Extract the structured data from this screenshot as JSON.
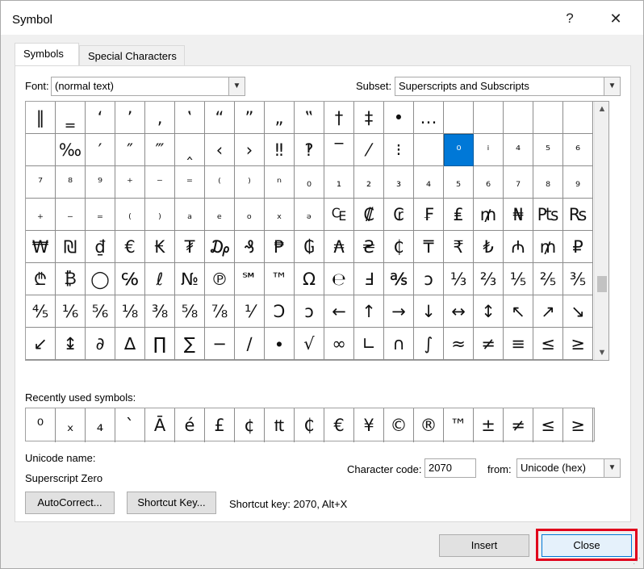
{
  "dialog": {
    "title": "Symbol",
    "help_label": "?",
    "close_label": "✕"
  },
  "tabs": [
    {
      "label": "Symbols",
      "active": true
    },
    {
      "label": "Special Characters",
      "active": false
    }
  ],
  "font": {
    "label": "Font:",
    "value": "(normal text)"
  },
  "subset": {
    "label": "Subset:",
    "value": "Superscripts and Subscripts"
  },
  "symbol_grid": {
    "rows": [
      [
        "‖",
        "‗",
        "‘",
        "’",
        "‚",
        "‛",
        "“",
        "”",
        "„",
        "‟",
        "†",
        "‡",
        "•",
        "…",
        "",
        "",
        "",
        ""
      ],
      [
        "",
        "‰",
        "′",
        "″",
        "‴",
        "‸",
        "‹",
        "›",
        "‼",
        "‽",
        "‾",
        "⁄",
        "⁝",
        "",
        "⁰",
        "ⁱ",
        "⁴",
        "⁵",
        "⁶"
      ],
      [
        "⁷",
        "⁸",
        "⁹",
        "⁺",
        "⁻",
        "⁼",
        "⁽",
        "⁾",
        "ⁿ",
        "₀",
        "₁",
        "₂",
        "₃",
        "₄",
        "₅",
        "₆",
        "₇",
        "₈",
        "₉"
      ],
      [
        "₊",
        "₋",
        "₌",
        "₍",
        "₎",
        "ₐ",
        "ₑ",
        "ₒ",
        "ₓ",
        "ₔ",
        "₠",
        "₡",
        "₢",
        "₣",
        "₤",
        "₥",
        "₦",
        "₧",
        "₨"
      ],
      [
        "₩",
        "₪",
        "₫",
        "€",
        "₭",
        "₮",
        "₯",
        "₰",
        "₱",
        "₲",
        "₳",
        "₴",
        "₵",
        "₸",
        "₹",
        "₺",
        "₼",
        "₥",
        "₽"
      ],
      [
        "₾",
        "₿",
        "◯",
        "℅",
        "ℓ",
        "№",
        "℗",
        "℠",
        "™",
        "Ω",
        "℮",
        "Ⅎ",
        "℁",
        "ↄ",
        "⅓",
        "⅔",
        "⅕",
        "⅖",
        "⅗"
      ],
      [
        "⅘",
        "⅙",
        "⅚",
        "⅛",
        "⅜",
        "⅝",
        "⅞",
        "⅟",
        "Ↄ",
        "ↄ",
        "←",
        "↑",
        "→",
        "↓",
        "↔",
        "↕",
        "↖",
        "↗",
        "↘"
      ],
      [
        "↙",
        "↨",
        "∂",
        "∆",
        "∏",
        "∑",
        "−",
        "∕",
        "∙",
        "√",
        "∞",
        "∟",
        "∩",
        "∫",
        "≈",
        "≠",
        "≡",
        "≤",
        "≥"
      ]
    ],
    "selected": "⁰"
  },
  "recent": {
    "label": "Recently used symbols:",
    "symbols": [
      "⁰",
      "ₓ",
      "₄",
      "`",
      "Ā",
      "é",
      "£",
      "¢",
      "₶",
      "₵",
      "€",
      "¥",
      "©",
      "®",
      "™",
      "±",
      "≠",
      "≤",
      "≥"
    ]
  },
  "unicode": {
    "name_label": "Unicode name:",
    "name_value": "Superscript Zero"
  },
  "char_code": {
    "label": "Character code:",
    "value": "2070"
  },
  "from": {
    "label": "from:",
    "value": "Unicode (hex)"
  },
  "buttons": {
    "autocorrect": "AutoCorrect...",
    "shortcut_key": "Shortcut Key...",
    "insert": "Insert",
    "close": "Close"
  },
  "shortcut_text": "Shortcut key: 2070, Alt+X"
}
